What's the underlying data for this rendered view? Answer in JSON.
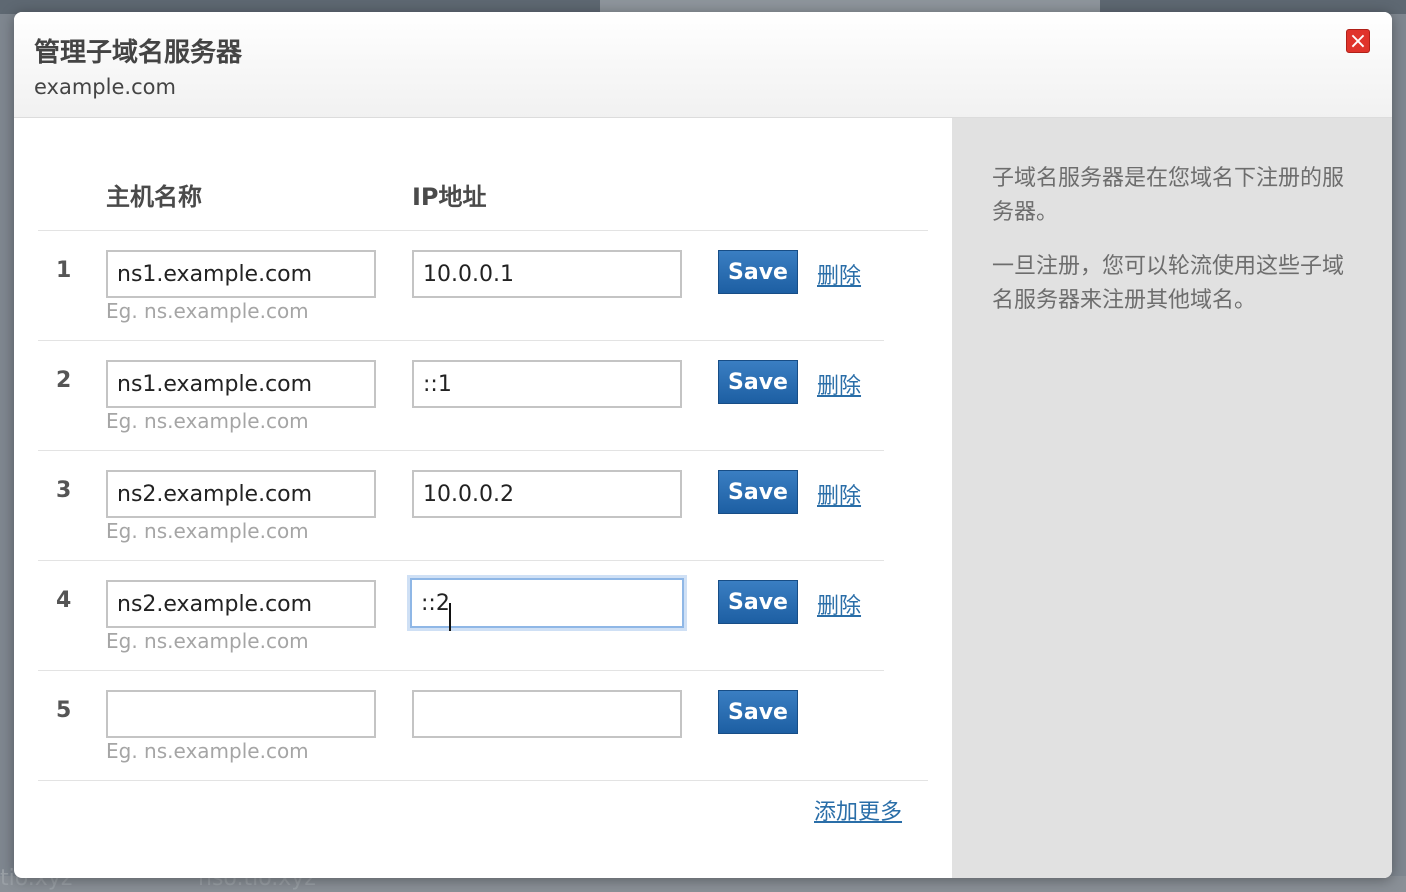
{
  "dialog": {
    "title": "管理子域名服务器",
    "subtitle": "example.com",
    "close_icon": "close-icon",
    "close_symbol": "×"
  },
  "table": {
    "headers": {
      "hostname": "主机名称",
      "ip": "IP地址"
    },
    "hint": "Eg. ns.example.com",
    "save_label": "Save",
    "delete_label": "删除",
    "rows": [
      {
        "num": "1",
        "hostname": "ns1.example.com",
        "ip": "10.0.0.1"
      },
      {
        "num": "2",
        "hostname": "ns1.example.com",
        "ip": "::1"
      },
      {
        "num": "3",
        "hostname": "ns2.example.com",
        "ip": "10.0.0.2"
      },
      {
        "num": "4",
        "hostname": "ns2.example.com",
        "ip": "::2"
      },
      {
        "num": "5",
        "hostname": "",
        "ip": ""
      }
    ],
    "add_more_label": "添加更多"
  },
  "sidebar": {
    "paragraph1": "子域名服务器是在您域名下注册的服务器。",
    "paragraph2": "一旦注册，您可以轮流使用这些子域名服务器来注册其他域名。"
  },
  "backdrop": {
    "text_left": "tio.xyz",
    "text_mid": "nso.tio.xyz"
  },
  "colors": {
    "accent": "#1d5fa3",
    "link": "#2a6ea8",
    "close": "#e0332b"
  }
}
